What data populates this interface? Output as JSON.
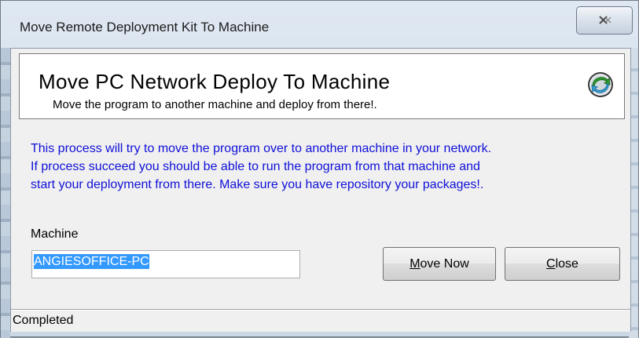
{
  "window": {
    "title": "Move Remote Deployment Kit To Machine",
    "close_glyph": "☒"
  },
  "header": {
    "title": "Move PC Network Deploy To Machine",
    "subtitle": "Move the program to another machine and deploy from there!.",
    "logo_icon": "green-arrow-refresh-icon"
  },
  "info": {
    "lines": [
      "This process will try to move the program over to another machine in your network.",
      "If process succeed you should be able to run the program from that machine and",
      "start your deployment from there. Make sure you have repository your packages!."
    ],
    "color": "#1010d8"
  },
  "form": {
    "machine_label": "Machine",
    "machine_value": "ANGIESOFFICE-PC"
  },
  "buttons": {
    "move_now": {
      "mnemonic": "M",
      "rest": "ove Now"
    },
    "close": {
      "mnemonic": "C",
      "rest": "lose"
    }
  },
  "status": {
    "text": "Completed"
  }
}
